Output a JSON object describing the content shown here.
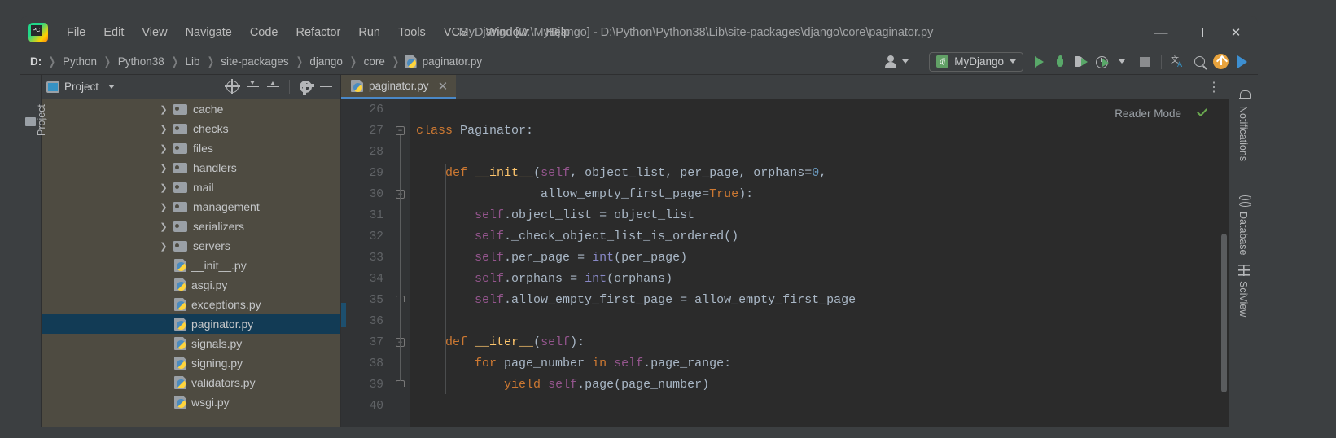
{
  "titlebar": {
    "logo_name": "pycharm-logo",
    "menus": [
      "File",
      "Edit",
      "View",
      "Navigate",
      "Code",
      "Refactor",
      "Run",
      "Tools",
      "VCS",
      "Window",
      "Help"
    ],
    "menu_mnemonics": [
      "F",
      "E",
      "V",
      "N",
      "C",
      "R",
      "R",
      "T",
      "S",
      "W",
      "H"
    ],
    "window_title": "MyDjango [D:\\MyDjango] - D:\\Python\\Python38\\Lib\\site-packages\\django\\core\\paginator.py",
    "minimize_label": "—",
    "maximize_label": "□",
    "close_label": "✕"
  },
  "navbar": {
    "breadcrumbs": [
      "D:",
      "Python",
      "Python38",
      "Lib",
      "site-packages",
      "django",
      "core",
      "paginator.py"
    ],
    "separator": "❯",
    "run_config": "MyDjango",
    "run_config_icon": "django-icon",
    "icons": [
      "user-icon",
      "run-icon",
      "debug-icon",
      "coverage-icon",
      "profile-icon",
      "stop-icon",
      "translate-icon",
      "search-icon",
      "update-icon",
      "blue-run-icon"
    ]
  },
  "left_strip": {
    "label": "Project"
  },
  "project_panel": {
    "title": "Project",
    "toolbar_icons": [
      "locate-icon",
      "expand-all-icon",
      "collapse-all-icon",
      "settings-gear-icon",
      "hide-icon"
    ],
    "tree": [
      {
        "label": "cache",
        "type": "folder",
        "expandable": true,
        "selected": false
      },
      {
        "label": "checks",
        "type": "folder",
        "expandable": true,
        "selected": false
      },
      {
        "label": "files",
        "type": "folder",
        "expandable": true,
        "selected": false
      },
      {
        "label": "handlers",
        "type": "folder",
        "expandable": true,
        "selected": false
      },
      {
        "label": "mail",
        "type": "folder",
        "expandable": true,
        "selected": false
      },
      {
        "label": "management",
        "type": "folder",
        "expandable": true,
        "selected": false
      },
      {
        "label": "serializers",
        "type": "folder",
        "expandable": true,
        "selected": false
      },
      {
        "label": "servers",
        "type": "folder",
        "expandable": true,
        "selected": false
      },
      {
        "label": "__init__.py",
        "type": "python",
        "expandable": false,
        "selected": false
      },
      {
        "label": "asgi.py",
        "type": "python",
        "expandable": false,
        "selected": false
      },
      {
        "label": "exceptions.py",
        "type": "python",
        "expandable": false,
        "selected": false
      },
      {
        "label": "paginator.py",
        "type": "python",
        "expandable": false,
        "selected": true
      },
      {
        "label": "signals.py",
        "type": "python",
        "expandable": false,
        "selected": false
      },
      {
        "label": "signing.py",
        "type": "python",
        "expandable": false,
        "selected": false
      },
      {
        "label": "validators.py",
        "type": "python",
        "expandable": false,
        "selected": false
      },
      {
        "label": "wsgi.py",
        "type": "python",
        "expandable": false,
        "selected": false
      }
    ]
  },
  "editor": {
    "tab": {
      "label": "paginator.py",
      "icon": "python-file-icon",
      "close": "✕"
    },
    "options_icon": "more-options-icon",
    "reader_mode_label": "Reader Mode",
    "reader_mode_check": "check-icon",
    "first_line_number": 26,
    "lines": [
      {
        "n": 26,
        "text": ""
      },
      {
        "n": 27,
        "text": "class Paginator:"
      },
      {
        "n": 28,
        "text": ""
      },
      {
        "n": 29,
        "text": "    def __init__(self, object_list, per_page, orphans=0,"
      },
      {
        "n": 30,
        "text": "                 allow_empty_first_page=True):"
      },
      {
        "n": 31,
        "text": "        self.object_list = object_list"
      },
      {
        "n": 32,
        "text": "        self._check_object_list_is_ordered()"
      },
      {
        "n": 33,
        "text": "        self.per_page = int(per_page)"
      },
      {
        "n": 34,
        "text": "        self.orphans = int(orphans)"
      },
      {
        "n": 35,
        "text": "        self.allow_empty_first_page = allow_empty_first_page"
      },
      {
        "n": 36,
        "text": ""
      },
      {
        "n": 37,
        "text": "    def __iter__(self):"
      },
      {
        "n": 38,
        "text": "        for page_number in self.page_range:"
      },
      {
        "n": 39,
        "text": "            yield self.page(page_number)"
      },
      {
        "n": 40,
        "text": ""
      }
    ],
    "colors": {
      "background": "#2b2b2b",
      "gutter": "#313335",
      "line_number": "#606366",
      "default_text": "#a9b7c6",
      "keyword": "#cc7832",
      "function_name": "#ffc66d",
      "self_keyword": "#94558d",
      "number": "#6897bb",
      "builtin": "#8888c6",
      "parameter": "#b3b8c4"
    }
  },
  "right_strip": {
    "items": [
      {
        "label": "Notifications",
        "icon": "bell-icon"
      },
      {
        "label": "Database",
        "icon": "database-icon"
      },
      {
        "label": "SciView",
        "icon": "grid-icon"
      }
    ]
  },
  "theme": {
    "window_bg": "#3c3f41",
    "sidebar_bg": "#4e4b41",
    "selection_bg": "#123b55",
    "tab_accent": "#4a88c7",
    "accent_green": "#59a869",
    "accent_orange": "#e8a33d"
  }
}
